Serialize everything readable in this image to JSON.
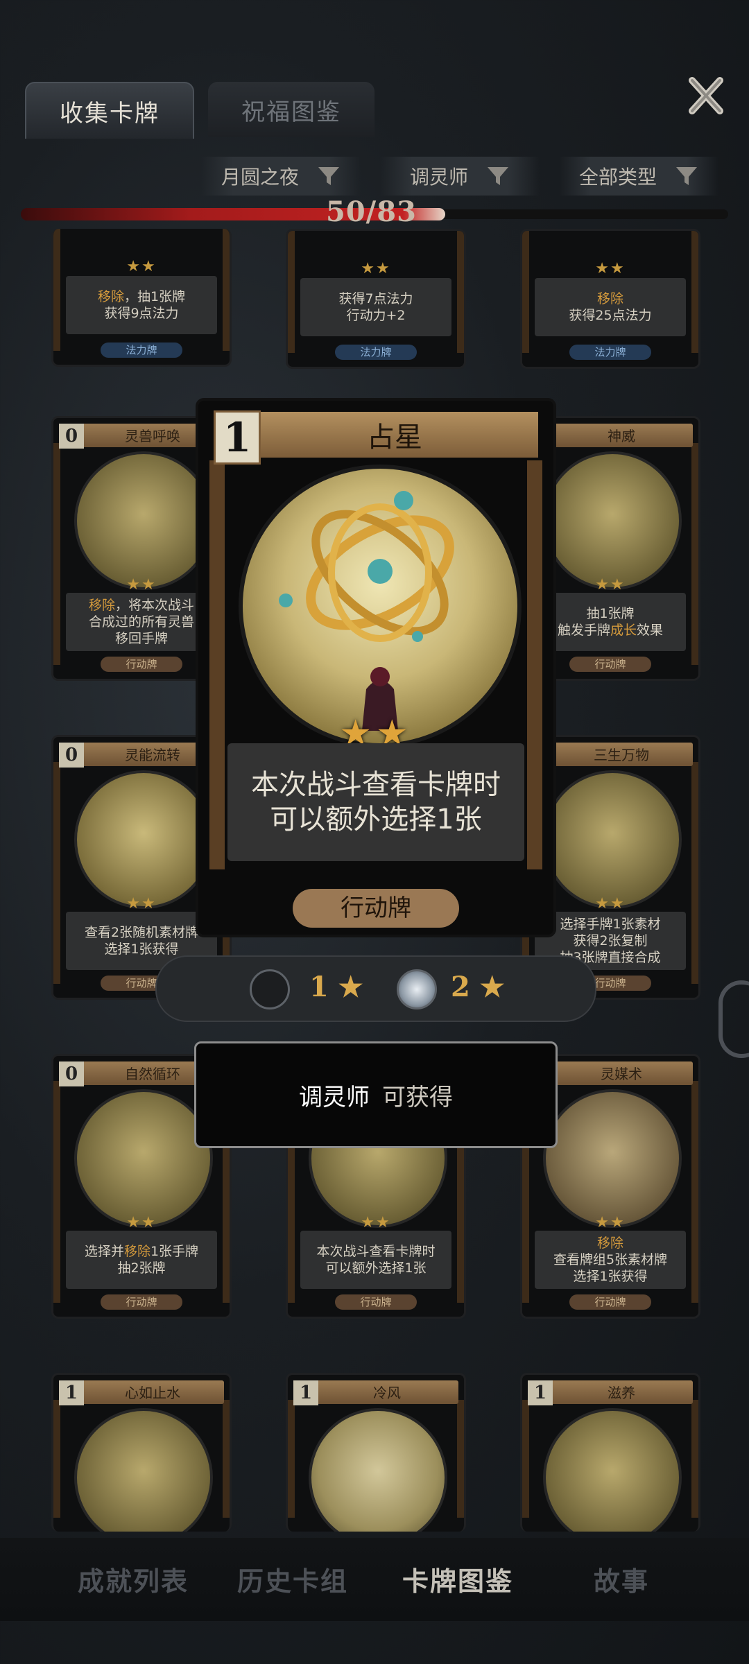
{
  "tabs": {
    "collect_cards": "收集卡牌",
    "blessing_codex": "祝福图鉴"
  },
  "filters": {
    "map": "月圆之夜",
    "class": "调灵师",
    "type": "全部类型"
  },
  "progress": {
    "text": "50/83",
    "collected": 50,
    "total": 83
  },
  "cards": {
    "r1c1": {
      "desc1_hl": "移除",
      "desc1_rest": "，抽1张牌",
      "desc2": "获得9点法力",
      "type": "法力牌"
    },
    "r1c2": {
      "desc1": "获得7点法力",
      "desc2": "行动力+2",
      "type": "法力牌"
    },
    "r1c3": {
      "desc1_hl": "移除",
      "desc2": "获得25点法力",
      "type": "法力牌"
    },
    "r2c1": {
      "cost": "0",
      "name": "灵兽呼唤",
      "desc1_hl": "移除",
      "desc1_rest": "，将本次战斗",
      "desc2": "合成过的所有灵兽",
      "desc3": "移回手牌",
      "type": "行动牌"
    },
    "r2c3": {
      "name": "神威",
      "desc1": "抽1张牌",
      "desc2_a": "触发手牌",
      "desc2_hl": "成长",
      "desc2_b": "效果",
      "type": "行动牌"
    },
    "r3c1": {
      "cost": "0",
      "name": "灵能流转",
      "desc1": "查看2张随机素材牌",
      "desc2": "选择1张获得",
      "type": "行动牌"
    },
    "r3c3": {
      "name": "三生万物",
      "desc1": "选择手牌1张素材",
      "desc2": "获得2张复制",
      "desc3": "抽3张牌直接合成",
      "type": "行动牌"
    },
    "r4c1": {
      "cost": "0",
      "name": "自然循环",
      "desc1_a": "选择并",
      "desc1_hl": "移除",
      "desc1_b": "1张手牌",
      "desc2": "抽2张牌",
      "type": "行动牌"
    },
    "r4c2": {
      "desc1": "本次战斗查看卡牌时",
      "desc2": "可以额外选择1张",
      "type": "行动牌"
    },
    "r4c3": {
      "name": "灵媒术",
      "desc1_hl": "移除",
      "desc2": "查看牌组5张素材牌",
      "desc3": "选择1张获得",
      "type": "行动牌"
    },
    "r5c1": {
      "cost": "1",
      "name": "心如止水"
    },
    "r5c2": {
      "cost": "1",
      "name": "冷风"
    },
    "r5c3": {
      "cost": "1",
      "name": "滋养"
    }
  },
  "featured": {
    "cost": "1",
    "name": "占星",
    "stars": "★★",
    "desc1": "本次战斗查看卡牌时",
    "desc2": "可以额外选择1张",
    "type": "行动牌"
  },
  "star_selector": {
    "opt1": "1",
    "opt2": "2",
    "star": "★"
  },
  "tooltip": {
    "class": "调灵师",
    "text": "可获得"
  },
  "bottom_nav": [
    "成就列表",
    "历史卡组",
    "卡牌图鉴",
    "故事"
  ],
  "colors": {
    "accent_gold": "#d49a3c",
    "progress_red": "#c22222",
    "card_wood": "#7d5d39"
  }
}
